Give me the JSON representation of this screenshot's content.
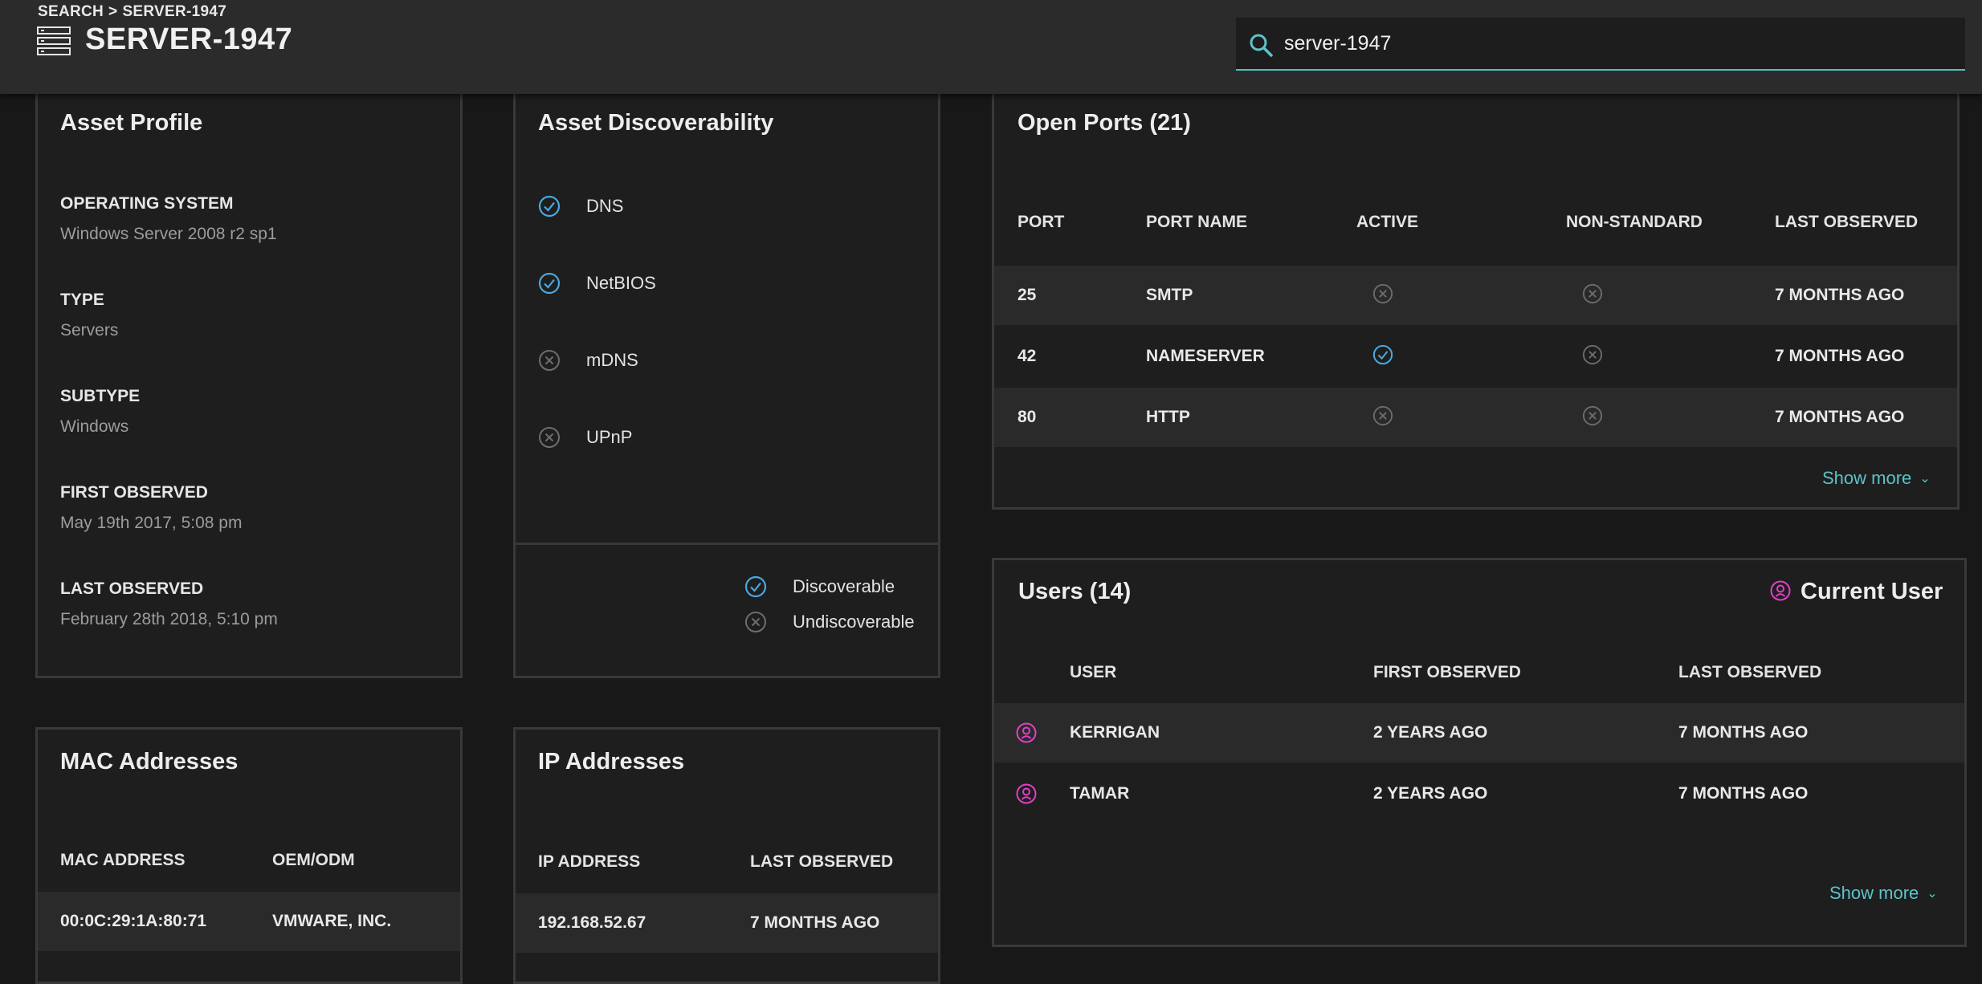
{
  "breadcrumb": {
    "root": "SEARCH",
    "separator": ">",
    "current": "SERVER-1947"
  },
  "page": {
    "title": "SERVER-1947",
    "icon": "server-list-icon"
  },
  "search": {
    "value": "server-1947",
    "icon": "search-icon"
  },
  "asset_profile": {
    "title": "Asset Profile",
    "fields": [
      {
        "label": "OPERATING SYSTEM",
        "value": "Windows Server 2008 r2 sp1"
      },
      {
        "label": "TYPE",
        "value": "Servers"
      },
      {
        "label": "SUBTYPE",
        "value": "Windows"
      },
      {
        "label": "FIRST OBSERVED",
        "value": "May 19th 2017, 5:08 pm"
      },
      {
        "label": "LAST OBSERVED",
        "value": "February 28th 2018, 5:10 pm"
      }
    ]
  },
  "discoverability": {
    "title": "Asset Discoverability",
    "items": [
      {
        "label": "DNS",
        "discoverable": true
      },
      {
        "label": "NetBIOS",
        "discoverable": true
      },
      {
        "label": "mDNS",
        "discoverable": false
      },
      {
        "label": "UPnP",
        "discoverable": false
      }
    ],
    "legend": {
      "discoverable": "Discoverable",
      "undiscoverable": "Undiscoverable"
    }
  },
  "open_ports": {
    "title": "Open Ports (21)",
    "columns": [
      "PORT",
      "PORT NAME",
      "ACTIVE",
      "NON-STANDARD",
      "LAST OBSERVED"
    ],
    "rows": [
      {
        "port": "25",
        "name": "SMTP",
        "active": false,
        "non_standard": false,
        "last_observed": "7 MONTHS AGO"
      },
      {
        "port": "42",
        "name": "NAMESERVER",
        "active": true,
        "non_standard": false,
        "last_observed": "7 MONTHS AGO"
      },
      {
        "port": "80",
        "name": "HTTP",
        "active": false,
        "non_standard": false,
        "last_observed": "7 MONTHS AGO"
      }
    ],
    "show_more": "Show more"
  },
  "users": {
    "title": "Users (14)",
    "current_user_label": "Current User",
    "columns": [
      "USER",
      "FIRST OBSERVED",
      "LAST OBSERVED"
    ],
    "rows": [
      {
        "user": "KERRIGAN",
        "first_observed": "2 YEARS AGO",
        "last_observed": "7 MONTHS AGO"
      },
      {
        "user": "TAMAR",
        "first_observed": "2 YEARS AGO",
        "last_observed": "7 MONTHS AGO"
      }
    ],
    "show_more": "Show more"
  },
  "mac_addresses": {
    "title": "MAC Addresses",
    "columns": [
      "MAC ADDRESS",
      "OEM/ODM"
    ],
    "rows": [
      {
        "mac": "00:0C:29:1A:80:71",
        "oem": "VMWARE, INC."
      }
    ]
  },
  "ip_addresses": {
    "title": "IP Addresses",
    "columns": [
      "IP ADDRESS",
      "LAST OBSERVED"
    ],
    "rows": [
      {
        "ip": "192.168.52.67",
        "last_observed": "7 MONTHS AGO"
      }
    ]
  },
  "colors": {
    "accent_teal": "#5cc3c9",
    "check_blue": "#4aa8e0",
    "x_gray": "#6d6d6d",
    "user_magenta": "#e040c8",
    "background": "#181818",
    "panel": "#1e1e1e",
    "topbar": "#2b2b2b"
  }
}
